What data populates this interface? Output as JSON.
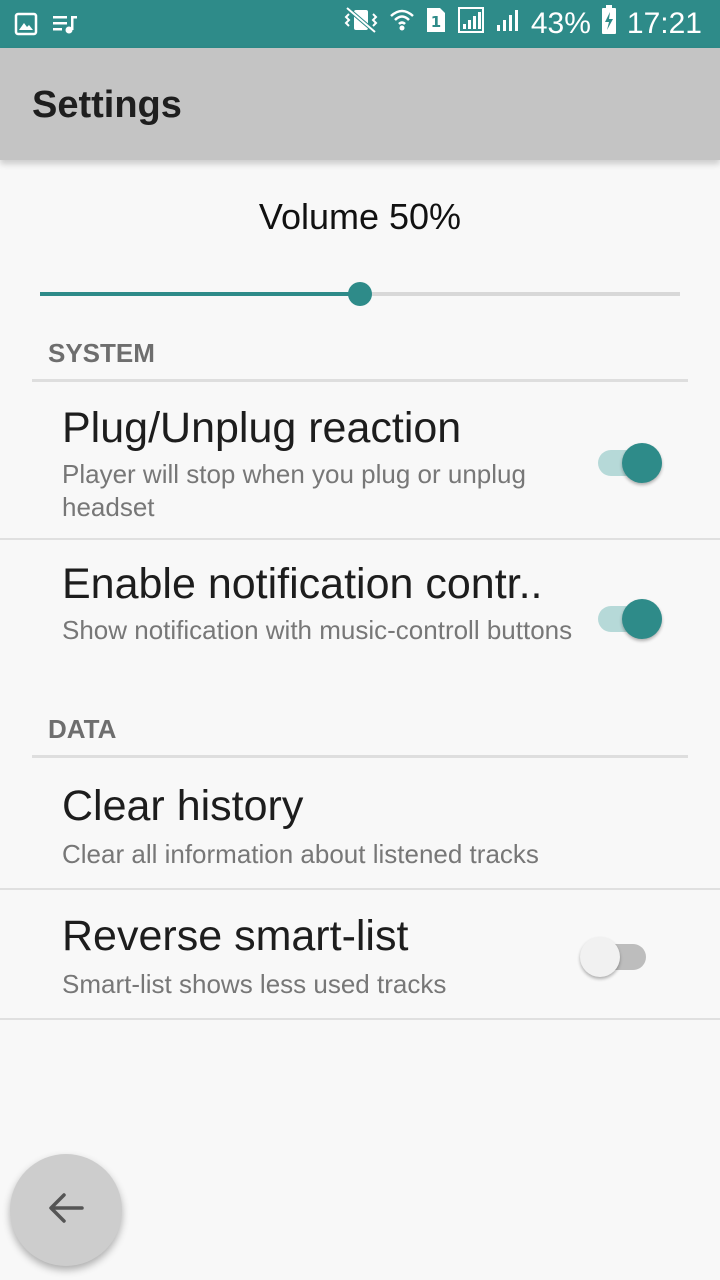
{
  "status_bar": {
    "left_icons": [
      "image-icon",
      "music-queue-icon"
    ],
    "right_icons": [
      "vibrate-icon",
      "wifi-icon",
      "sim-1-icon",
      "signal-1-icon",
      "signal-2-icon"
    ],
    "battery": "43%",
    "battery_icon": "battery-charging-icon",
    "time": "17:21"
  },
  "app_bar": {
    "title": "Settings"
  },
  "volume": {
    "label": "Volume 50%",
    "value": 0.5
  },
  "sections": {
    "system": {
      "header": "SYSTEM",
      "items": [
        {
          "title": "Plug/Unplug reaction",
          "subtitle": "Player will stop when you plug or unplug headset",
          "toggle": true
        },
        {
          "title": "Enable notification contr..",
          "subtitle": "Show notification with music-controll buttons",
          "toggle": true
        }
      ]
    },
    "data": {
      "header": "DATA",
      "items": [
        {
          "title": "Clear history",
          "subtitle": "Clear all information about listened tracks"
        },
        {
          "title": "Reverse smart-list",
          "subtitle": "Smart-list shows less used tracks",
          "toggle": false
        }
      ]
    }
  },
  "fab": {
    "icon": "arrow-back-icon"
  },
  "colors": {
    "accent": "#2e8b89",
    "app_bar": "#c4c4c4",
    "background": "#f8f8f8"
  }
}
